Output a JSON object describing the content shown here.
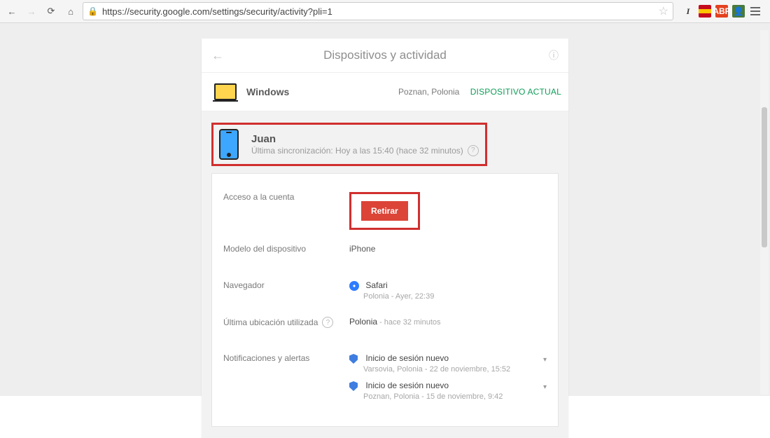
{
  "browser": {
    "url": "https://security.google.com/settings/security/activity?pli=1"
  },
  "header": {
    "title": "Dispositivos y actividad"
  },
  "current_device": {
    "os": "Windows",
    "location": "Poznan, Polonia",
    "tag": "DISPOSITIVO ACTUAL"
  },
  "selected_device": {
    "name": "Juan",
    "sync": "Última sincronización: Hoy a las 15:40 (hace 32 minutos)"
  },
  "details": {
    "access_label": "Acceso a la cuenta",
    "retirar_label": "Retirar",
    "model_label": "Modelo del dispositivo",
    "model_value": "iPhone",
    "browser_label": "Navegador",
    "browser_value": "Safari",
    "browser_sub": "Polonia - Ayer, 22:39",
    "location_label": "Última ubicación utilizada",
    "location_value": "Polonia",
    "location_sub": " - hace 32 minutos",
    "alerts_label": "Notificaciones y alertas",
    "alerts": [
      {
        "title": "Inicio de sesión nuevo",
        "sub": "Varsovia, Polonia - 22 de noviembre, 15:52"
      },
      {
        "title": "Inicio de sesión nuevo",
        "sub": "Poznan, Polonia - 15 de noviembre, 9:42"
      }
    ]
  }
}
